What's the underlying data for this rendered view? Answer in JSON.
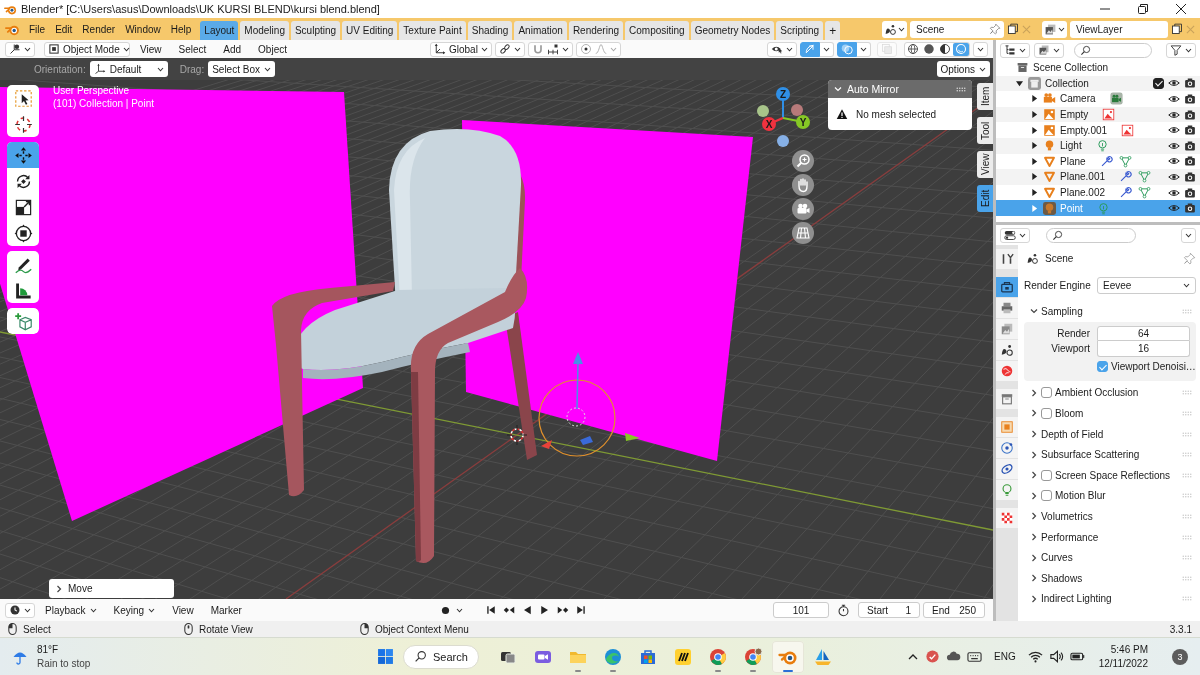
{
  "title_bar": {
    "title": "Blender* [C:\\Users\\asus\\Downloads\\UK KURSI BLEND\\kursi blend.blend]"
  },
  "menu": [
    "File",
    "Edit",
    "Render",
    "Window",
    "Help"
  ],
  "workspaces": [
    {
      "label": "Layout",
      "selected": true
    },
    {
      "label": "Modeling",
      "selected": false
    },
    {
      "label": "Sculpting",
      "selected": false
    },
    {
      "label": "UV Editing",
      "selected": false
    },
    {
      "label": "Texture Paint",
      "selected": false
    },
    {
      "label": "Shading",
      "selected": false
    },
    {
      "label": "Animation",
      "selected": false
    },
    {
      "label": "Rendering",
      "selected": false
    },
    {
      "label": "Compositing",
      "selected": false
    },
    {
      "label": "Geometry Nodes",
      "selected": false
    },
    {
      "label": "Scripting",
      "selected": false
    }
  ],
  "add_workspace": "+",
  "scene": "Scene",
  "view_layer": "ViewLayer",
  "viewport_header": {
    "mode": "Object Mode",
    "menus": [
      "View",
      "Select",
      "Add",
      "Object"
    ],
    "transform_orientation": "Global",
    "gizmos_on": true,
    "overlays_on": true,
    "shading": [
      {
        "selected": false
      },
      {
        "selected": false
      },
      {
        "selected": false
      },
      {
        "selected": true
      }
    ]
  },
  "tool_settings": {
    "orientation_label": "Orientation:",
    "orientation": "Default",
    "drag_label": "Drag:",
    "drag": "Select Box",
    "options": "Options"
  },
  "toolbar": [
    {
      "tools": [
        {
          "selected": false
        },
        {
          "selected": false
        }
      ]
    },
    {
      "tools": [
        {
          "selected": true
        },
        {
          "selected": false
        },
        {
          "selected": false
        },
        {
          "selected": false
        }
      ]
    },
    {
      "tools": [
        {
          "selected": false
        },
        {
          "selected": false
        }
      ]
    },
    {
      "tools": [
        {
          "selected": false
        }
      ]
    }
  ],
  "viewport": {
    "view_name": "User Perspective",
    "object_info": "(101) Collection | Point",
    "axes": [
      {
        "label": "Z",
        "color": "#2f8fe6"
      },
      {
        "label": "X",
        "color": "#f0323f"
      },
      {
        "label": "Y",
        "color": "#86c825"
      }
    ]
  },
  "auto_mirror": {
    "title": "Auto Mirror",
    "message": "No mesh selected",
    "expanded": true
  },
  "sidebar_tabs": [
    {
      "label": "Item",
      "selected": false
    },
    {
      "label": "Tool",
      "selected": false
    },
    {
      "label": "View",
      "selected": false
    },
    {
      "label": "Edit",
      "selected": true
    }
  ],
  "last_operation": {
    "label": "Move",
    "expanded": false
  },
  "timeline": {
    "menus": [
      {
        "label": "Playback",
        "kind": "dropdown"
      },
      {
        "label": "Keying",
        "kind": "dropdown"
      },
      {
        "label": "View",
        "kind": "plain"
      },
      {
        "label": "Marker",
        "kind": "plain"
      }
    ],
    "current_frame": "101",
    "start_label": "Start",
    "start": "1",
    "end_label": "End",
    "end": "250"
  },
  "outliner": {
    "root": "Scene Collection",
    "collections": [
      {
        "name": "Collection",
        "expanded": true,
        "checked": true,
        "children": [
          {
            "name": "Camera",
            "kind": "camera",
            "expanded": false,
            "selected": false
          },
          {
            "name": "Empty",
            "kind": "empty",
            "expanded": false,
            "selected": false
          },
          {
            "name": "Empty.001",
            "kind": "empty",
            "expanded": false,
            "selected": false
          },
          {
            "name": "Light",
            "kind": "light",
            "expanded": false,
            "selected": false
          },
          {
            "name": "Plane",
            "kind": "mesh",
            "expanded": false,
            "selected": false
          },
          {
            "name": "Plane.001",
            "kind": "mesh",
            "expanded": false,
            "selected": false
          },
          {
            "name": "Plane.002",
            "kind": "mesh",
            "expanded": false,
            "selected": false
          },
          {
            "name": "Point",
            "kind": "light",
            "expanded": false,
            "selected": true
          }
        ]
      }
    ]
  },
  "properties": {
    "tabs": [
      {
        "selected": false
      },
      {
        "selected": true
      },
      {
        "selected": false
      },
      {
        "selected": false
      },
      {
        "selected": false
      },
      {
        "selected": false
      },
      {
        "selected": false
      },
      {
        "selected": false
      },
      {
        "selected": false
      },
      {
        "selected": false
      },
      {
        "selected": false
      },
      {
        "selected": false
      }
    ],
    "context": "Scene",
    "render_engine_label": "Render Engine",
    "render_engine": "Eevee",
    "panels": [
      {
        "title": "Sampling",
        "kind": "plain",
        "expanded": true,
        "fields": [
          {
            "label": "Render",
            "value": "64"
          },
          {
            "label": "Viewport",
            "value": "16"
          }
        ],
        "options": [
          {
            "label": "Viewport Denoisi…",
            "checked": true
          }
        ]
      },
      {
        "title": "Ambient Occlusion",
        "kind": "toggle",
        "checked": false,
        "expanded": false
      },
      {
        "title": "Bloom",
        "kind": "toggle",
        "checked": false,
        "expanded": false
      },
      {
        "title": "Depth of Field",
        "kind": "plain",
        "expanded": false
      },
      {
        "title": "Subsurface Scattering",
        "kind": "plain",
        "expanded": false
      },
      {
        "title": "Screen Space Reflections",
        "kind": "toggle",
        "checked": false,
        "expanded": false
      },
      {
        "title": "Motion Blur",
        "kind": "toggle",
        "checked": false,
        "expanded": false
      },
      {
        "title": "Volumetrics",
        "kind": "plain",
        "expanded": false
      },
      {
        "title": "Performance",
        "kind": "plain",
        "expanded": false
      },
      {
        "title": "Curves",
        "kind": "plain",
        "expanded": false
      },
      {
        "title": "Shadows",
        "kind": "plain",
        "expanded": false
      },
      {
        "title": "Indirect Lighting",
        "kind": "plain",
        "expanded": false
      }
    ]
  },
  "status_bar": {
    "hints": [
      "Select",
      "Rotate View",
      "Object Context Menu"
    ],
    "version": "3.3.1"
  },
  "taskbar": {
    "weather": {
      "temperature": "81°F",
      "condition": "Rain to stop"
    },
    "search": "Search",
    "apps": [
      {
        "running": false,
        "selected": false
      },
      {
        "running": false,
        "selected": false
      },
      {
        "running": true,
        "selected": false
      },
      {
        "running": true,
        "selected": false
      },
      {
        "running": false,
        "selected": false
      },
      {
        "running": false,
        "selected": false
      },
      {
        "running": true,
        "selected": false
      },
      {
        "running": true,
        "selected": false
      },
      {
        "running": true,
        "selected": true
      },
      {
        "running": false,
        "selected": false
      }
    ],
    "language": "ENG",
    "time": "5:46 PM",
    "date": "12/11/2022",
    "notifications": "3"
  }
}
